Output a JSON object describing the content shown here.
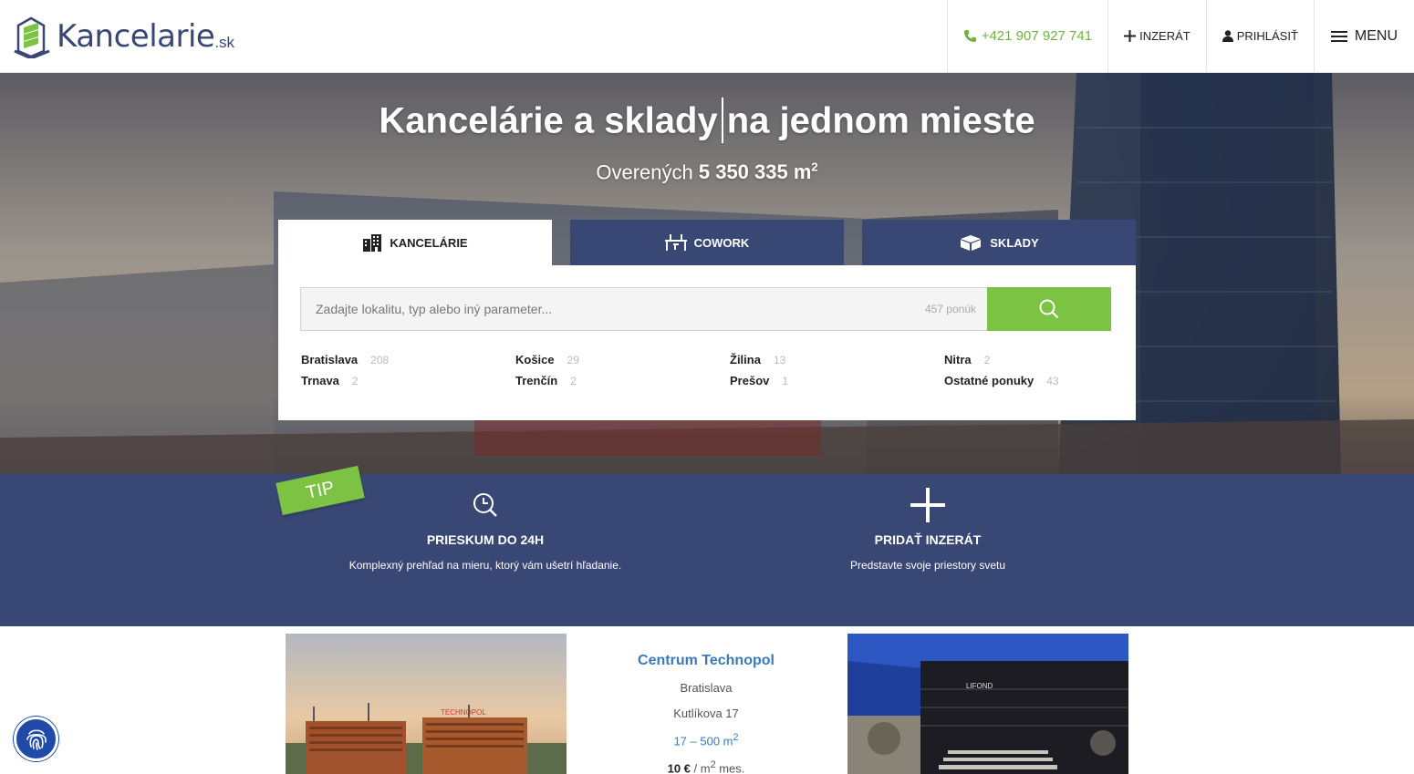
{
  "header": {
    "logo_text": "Kancelarie",
    "logo_suffix": ".sk",
    "phone": "+421 907 927 741",
    "add_listing": "INZERÁT",
    "login": "PRIHLÁSIŤ",
    "menu": "MENU"
  },
  "hero": {
    "title_part1": "Kancelárie a sklady",
    "title_part2": "na jednom mieste",
    "subtitle_prefix": "Overených",
    "subtitle_value": "5 350 335 m",
    "subtitle_sup": "2"
  },
  "tabs": [
    {
      "label": "KANCELÁRIE",
      "icon": "building-icon",
      "active": true
    },
    {
      "label": "COWORK",
      "icon": "desk-icon",
      "active": false
    },
    {
      "label": "SKLADY",
      "icon": "box-icon",
      "active": false
    }
  ],
  "search": {
    "placeholder": "Zadajte lokalitu, typ alebo iný parameter...",
    "count": "457 ponúk"
  },
  "cities": [
    {
      "name": "Bratislava",
      "count": "208"
    },
    {
      "name": "Košice",
      "count": "29"
    },
    {
      "name": "Žilina",
      "count": "13"
    },
    {
      "name": "Nitra",
      "count": "2"
    },
    {
      "name": "Trnava",
      "count": "2"
    },
    {
      "name": "Trenčín",
      "count": "2"
    },
    {
      "name": "Prešov",
      "count": "1"
    },
    {
      "name": "Ostatné ponuky",
      "count": "43"
    }
  ],
  "band": {
    "tip": "TIP",
    "feature1": {
      "title": "PRIESKUM DO 24H",
      "desc": "Komplexný prehľad na mieru, ktorý vám ušetrí hľadanie."
    },
    "feature2": {
      "title": "PRIDAŤ INZERÁT",
      "desc": "Predstavte svoje priestory svetu"
    }
  },
  "listing": {
    "name": "Centrum Technopol",
    "city": "Bratislava",
    "street": "Kutlíkova 17",
    "area": "17 – 500 m",
    "area_sup": "2",
    "price_value": "10 €",
    "price_unit_prefix": " / m",
    "price_unit_sup": "2",
    "price_unit_suffix": " mes.",
    "img1_sign": "TECHNOPOL",
    "img2_sign": "LIFOND"
  },
  "colors": {
    "brand_blue": "#394774",
    "brand_green": "#7cc243",
    "link_blue": "#3b7ab8"
  }
}
